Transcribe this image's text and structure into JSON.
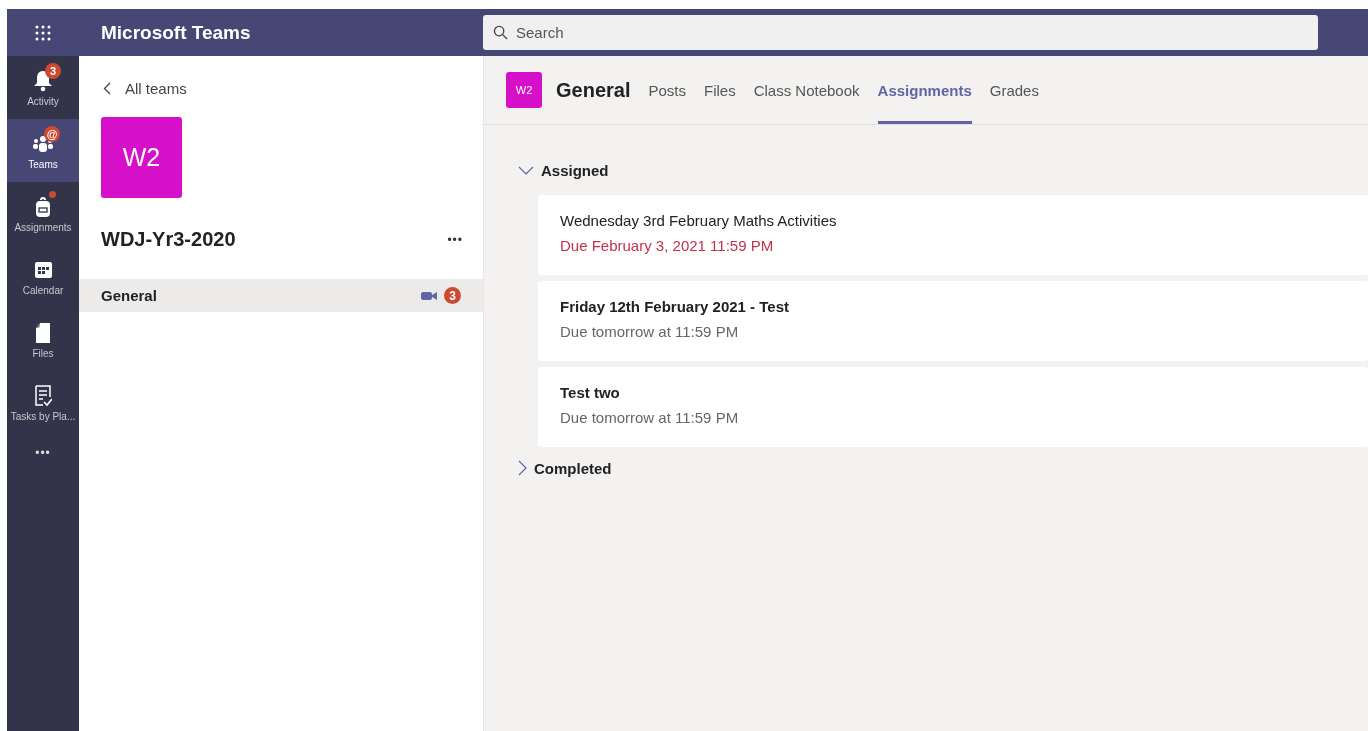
{
  "app": {
    "title": "Microsoft Teams"
  },
  "search": {
    "placeholder": "Search"
  },
  "rail": [
    {
      "label": "Activity",
      "kind": "bell",
      "selected": false,
      "badge": "3",
      "dot": false
    },
    {
      "label": "Teams",
      "kind": "teams",
      "selected": true,
      "badge": "@",
      "dot": false
    },
    {
      "label": "Assignments",
      "kind": "bag",
      "selected": false,
      "dot": true
    },
    {
      "label": "Calendar",
      "kind": "calendar",
      "selected": false,
      "dot": false
    },
    {
      "label": "Files",
      "kind": "file",
      "selected": false,
      "dot": false
    },
    {
      "label": "Tasks by Pla...",
      "kind": "tasks",
      "selected": false,
      "dot": false
    }
  ],
  "rail_more": "•••",
  "team_panel": {
    "back": "All teams",
    "avatar": "W2",
    "name": "WDJ-Yr3-2020",
    "more": "•••",
    "channels": [
      {
        "name": "General",
        "selected": true,
        "meeting": true,
        "badge": "3"
      }
    ]
  },
  "channel": {
    "avatar": "W2",
    "name": "General",
    "tabs": [
      {
        "label": "Posts",
        "selected": false
      },
      {
        "label": "Files",
        "selected": false
      },
      {
        "label": "Class Notebook",
        "selected": false
      },
      {
        "label": "Assignments",
        "selected": true
      },
      {
        "label": "Grades",
        "selected": false
      }
    ]
  },
  "sections": [
    {
      "title": "Assigned",
      "expanded": true,
      "items": [
        {
          "title": "Wednesday 3rd February Maths Activities",
          "due": "Due February 3, 2021 11:59 PM",
          "overdue": true,
          "unread": false
        },
        {
          "title": "Friday 12th February 2021 - Test",
          "due": "Due tomorrow at 11:59 PM",
          "overdue": false,
          "unread": true
        },
        {
          "title": "Test two",
          "due": "Due tomorrow at 11:59 PM",
          "overdue": false,
          "unread": true
        }
      ]
    },
    {
      "title": "Completed",
      "expanded": false
    }
  ]
}
